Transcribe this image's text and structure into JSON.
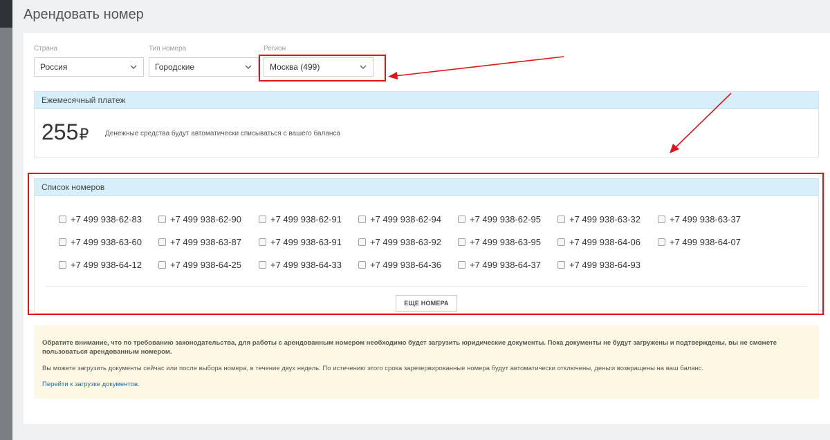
{
  "page": {
    "title": "Арендовать номер"
  },
  "filters": {
    "country": {
      "label": "Страна",
      "value": "Россия"
    },
    "number_type": {
      "label": "Тип номера",
      "value": "Городские"
    },
    "region": {
      "label": "Регион",
      "value": "Москва (499)"
    }
  },
  "payment": {
    "header": "Ежемесячный платеж",
    "amount": "255",
    "currency": "₽",
    "note": "Денежные средства будут автоматически списываться с вашего баланса"
  },
  "numbers": {
    "header": "Список номеров",
    "items": [
      "+7 499 938-62-83",
      "+7 499 938-62-90",
      "+7 499 938-62-91",
      "+7 499 938-62-94",
      "+7 499 938-62-95",
      "+7 499 938-63-32",
      "+7 499 938-63-37",
      "+7 499 938-63-60",
      "+7 499 938-63-87",
      "+7 499 938-63-91",
      "+7 499 938-63-92",
      "+7 499 938-63-95",
      "+7 499 938-64-06",
      "+7 499 938-64-07",
      "+7 499 938-64-12",
      "+7 499 938-64-25",
      "+7 499 938-64-33",
      "+7 499 938-64-36",
      "+7 499 938-64-37",
      "+7 499 938-64-93"
    ],
    "more_button": "ЕЩЕ НОМЕРА"
  },
  "notice": {
    "warning": "Обратите внимание, что по требованию законодательства, для работы с арендованным номером необходимо будет загрузить юридические документы. Пока документы не будут загружены и подтверждены, вы не сможете пользоваться арендованным номером.",
    "info": "Вы можете загрузить документы сейчас или после выбора номера, в течение двух недель. По истечению этого срока зарезервированные номера будут автоматически отключены, деньги возвращены на ваш баланс.",
    "link": "Перейти к загрузке документов."
  },
  "colors": {
    "highlight": "#e0141a",
    "header_bg": "#d7effa",
    "notice_bg": "#fcf8e3"
  },
  "icons": {
    "dropdown": "chevron-down-icon",
    "checkbox": "checkbox-icon"
  }
}
